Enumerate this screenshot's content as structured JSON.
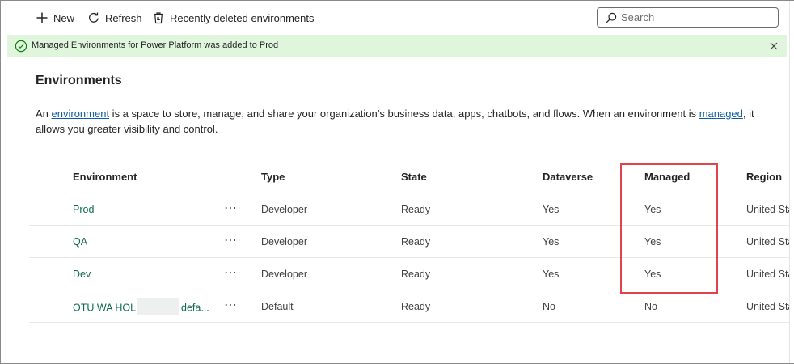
{
  "toolbar": {
    "new_label": "New",
    "refresh_label": "Refresh",
    "recently_deleted_label": "Recently deleted environments",
    "search_placeholder": "Search"
  },
  "banner": {
    "message": "Managed Environments for Power Platform was added to Prod",
    "color": "#dff6dd"
  },
  "page": {
    "title": "Environments",
    "desc_prefix": "An ",
    "desc_link1": "environment",
    "desc_middle": " is a space to store, manage, and share your organization’s business data, apps, chatbots, and flows. When an environment is ",
    "desc_link2": "managed",
    "desc_suffix": ", it allows you greater visibility and control."
  },
  "table": {
    "columns": [
      "Environment",
      "Type",
      "State",
      "Dataverse",
      "Managed",
      "Region"
    ],
    "more_label": "⋯",
    "rows": [
      {
        "name": "Prod",
        "type": "Developer",
        "state": "Ready",
        "dataverse": "Yes",
        "managed": "Yes",
        "region": "United Sta"
      },
      {
        "name": "QA",
        "type": "Developer",
        "state": "Ready",
        "dataverse": "Yes",
        "managed": "Yes",
        "region": "United Sta"
      },
      {
        "name": "Dev",
        "type": "Developer",
        "state": "Ready",
        "dataverse": "Yes",
        "managed": "Yes",
        "region": "United Sta"
      },
      {
        "name_part1": "OTU WA HOL",
        "name_part2": "defa...",
        "type": "Default",
        "state": "Ready",
        "dataverse": "No",
        "managed": "No",
        "region": "United Sta"
      }
    ]
  },
  "colors": {
    "highlight": "#e0434b",
    "link": "#115ea3",
    "env_name": "#0f6b4e"
  }
}
